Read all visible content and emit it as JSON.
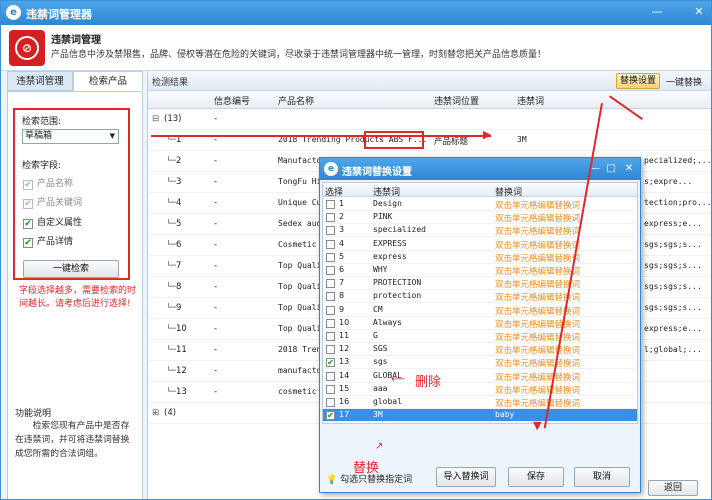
{
  "app": {
    "title": "违禁词管理器"
  },
  "header": {
    "title": "违禁词管理",
    "desc": "产品信息中涉及禁限售，品牌、侵权等潜在危险的关键词，尽收录于违禁词管理器中统一管理，时刻替您把关产品信息质量！"
  },
  "tabs": [
    {
      "label": "违禁词管理"
    },
    {
      "label": "检索产品"
    }
  ],
  "left": {
    "range_label": "检索范围:",
    "range_value": "草稿箱",
    "field_label": "检索字段:",
    "fields": [
      {
        "label": "产品名称",
        "checked": true,
        "disabled": true
      },
      {
        "label": "产品关键词",
        "checked": true,
        "disabled": true
      },
      {
        "label": "自定义属性",
        "checked": true,
        "disabled": false
      },
      {
        "label": "产品详情",
        "checked": true,
        "disabled": false
      }
    ],
    "search_button": "一键检索",
    "warning": "字段选择越多，需要检索的时间越长。请考虑后进行选择!",
    "func_title": "功能说明",
    "func_desc": "检索您现有产品中是否存在违禁词，并可将违禁词替换成您所需的合法词组。"
  },
  "right": {
    "section_label": "检测结果",
    "replace_settings": "替换设置",
    "one_click_replace": "一键替换",
    "back_button": "返回",
    "columns": [
      "信息编号",
      "产品名称",
      "违禁词位置",
      "违禁词"
    ],
    "group1": "(13)",
    "group2": "(4)",
    "rows": [
      {
        "no": "1",
        "id": "-",
        "name": "2018 Trending Products ABS F...",
        "pos": "产品标题",
        "word": "3M"
      },
      {
        "no": "2",
        "id": "-",
        "name": "Manufacto",
        "pos": "",
        "word": "pecialized;..."
      },
      {
        "no": "3",
        "id": "-",
        "name": "TongFu Hi",
        "pos": "",
        "word": "s;expre..."
      },
      {
        "no": "4",
        "id": "-",
        "name": "Unique Cu",
        "pos": "",
        "word": "tection;pro..."
      },
      {
        "no": "5",
        "id": "-",
        "name": "Sedex aud",
        "pos": "",
        "word": "express;e..."
      },
      {
        "no": "6",
        "id": "-",
        "name": "Cosmetic",
        "pos": "",
        "word": "sgs;sgs;s..."
      },
      {
        "no": "7",
        "id": "-",
        "name": "Top Quali",
        "pos": "",
        "word": "sgs;sgs;s..."
      },
      {
        "no": "8",
        "id": "-",
        "name": "Top Quali",
        "pos": "",
        "word": "sgs;sgs;s..."
      },
      {
        "no": "9",
        "id": "-",
        "name": "Top Quali",
        "pos": "",
        "word": "sgs;sgs;s..."
      },
      {
        "no": "10",
        "id": "-",
        "name": "Top Quali",
        "pos": "",
        "word": "express;e..."
      },
      {
        "no": "11",
        "id": "-",
        "name": "2018 Tren",
        "pos": "",
        "word": "l;global;..."
      },
      {
        "no": "12",
        "id": "-",
        "name": "manufacto",
        "pos": "",
        "word": ""
      },
      {
        "no": "13",
        "id": "-",
        "name": "cosmetic",
        "pos": "",
        "word": ""
      }
    ]
  },
  "dialog": {
    "title": "违禁词替换设置",
    "cols": [
      "选择",
      "违禁词",
      "替换词"
    ],
    "rows": [
      {
        "n": "1",
        "word": "Design",
        "rep": "双击单元格编辑替换词",
        "checked": false
      },
      {
        "n": "2",
        "word": "PINK",
        "rep": "双击单元格编辑替换词",
        "checked": false
      },
      {
        "n": "3",
        "word": "specialized",
        "rep": "双击单元格编辑替换词",
        "checked": false
      },
      {
        "n": "4",
        "word": "EXPRESS",
        "rep": "双击单元格编辑替换词",
        "checked": false
      },
      {
        "n": "5",
        "word": "express",
        "rep": "双击单元格编辑替换词",
        "checked": false
      },
      {
        "n": "6",
        "word": "WHY",
        "rep": "双击单元格编辑替换词",
        "checked": false
      },
      {
        "n": "7",
        "word": "PROTECTION",
        "rep": "双击单元格编辑替换词",
        "checked": false
      },
      {
        "n": "8",
        "word": "protection",
        "rep": "双击单元格编辑替换词",
        "checked": false
      },
      {
        "n": "9",
        "word": "CM",
        "rep": "双击单元格编辑替换词",
        "checked": false
      },
      {
        "n": "10",
        "word": "Always",
        "rep": "双击单元格编辑替换词",
        "checked": false
      },
      {
        "n": "11",
        "word": "G",
        "rep": "双击单元格编辑替换词",
        "checked": false
      },
      {
        "n": "12",
        "word": "SGS",
        "rep": "双击单元格编辑替换词",
        "checked": false
      },
      {
        "n": "13",
        "word": "sgs",
        "rep": "双击单元格编辑替换词",
        "checked": true
      },
      {
        "n": "14",
        "word": "GLOBAL",
        "rep": "双击单元格编辑替换词",
        "checked": false
      },
      {
        "n": "15",
        "word": "aaa",
        "rep": "双击单元格编辑替换词",
        "checked": false
      },
      {
        "n": "16",
        "word": "global",
        "rep": "双击单元格编辑替换词",
        "checked": false
      },
      {
        "n": "17",
        "word": "3M",
        "rep": "baby",
        "checked": true
      }
    ],
    "tip": "勾选只替换指定词",
    "import_button": "导入替换词",
    "save_button": "保存",
    "cancel_button": "取消"
  },
  "annotations": {
    "delete": "删除",
    "replace": "替换"
  }
}
